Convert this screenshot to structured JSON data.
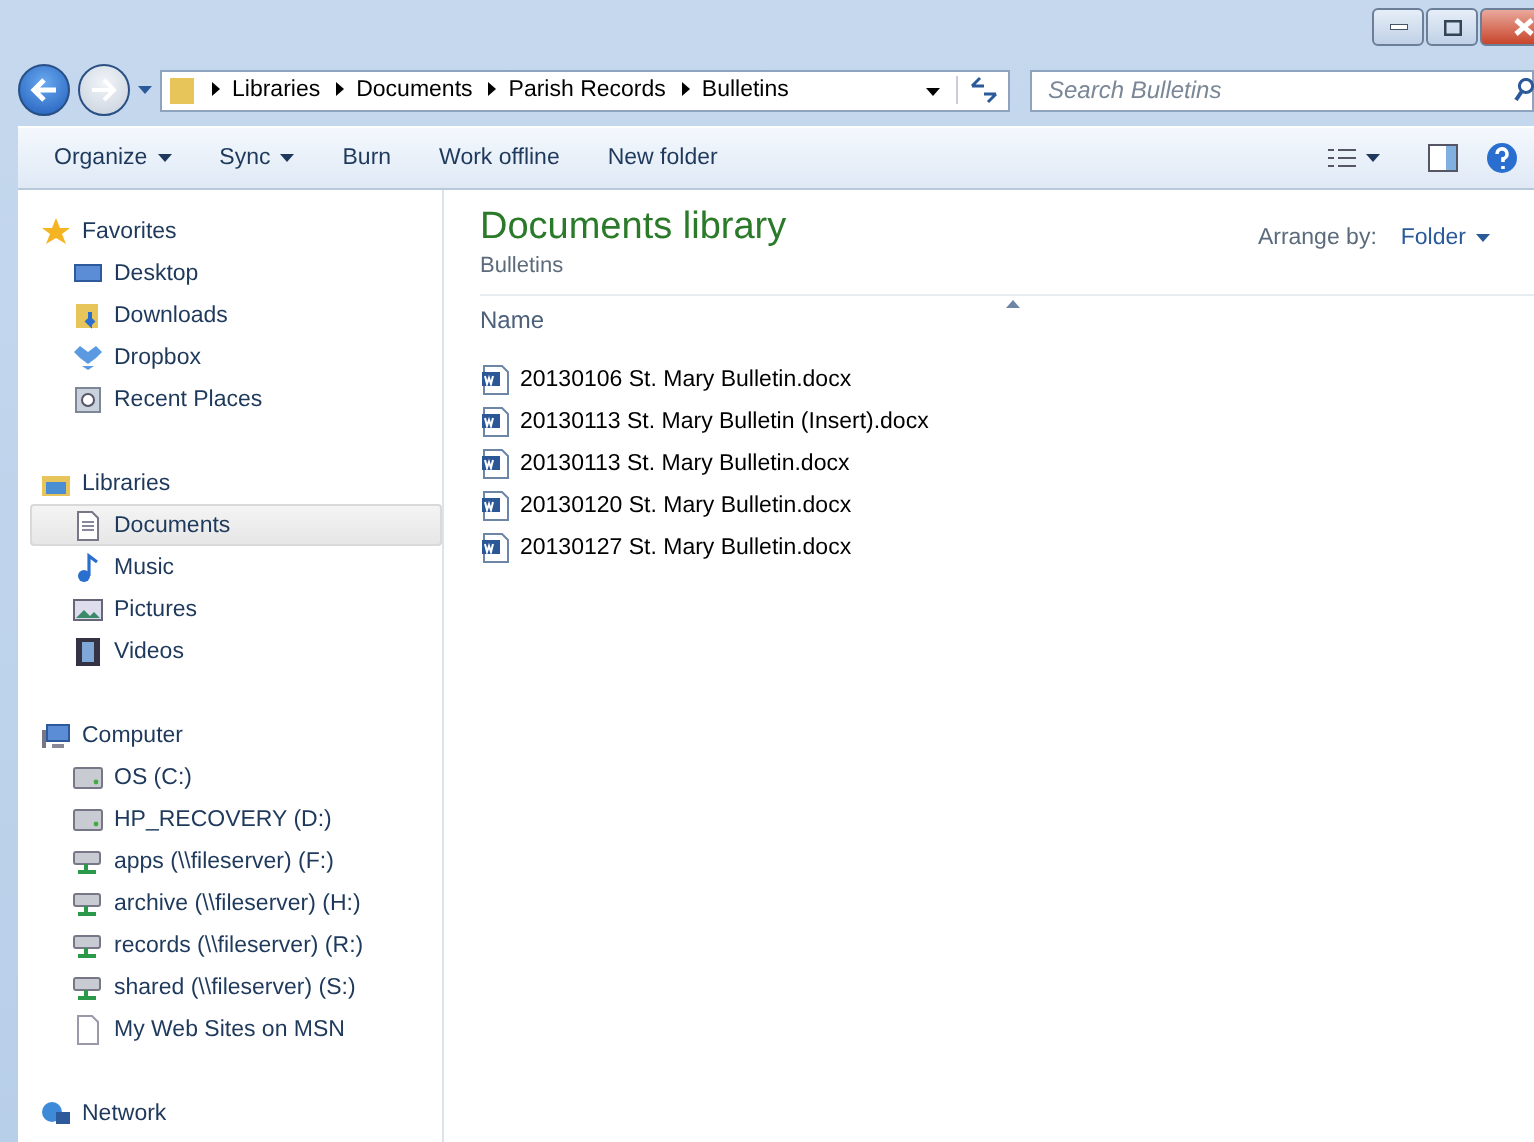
{
  "address_bar": {
    "breadcrumbs": [
      "Libraries",
      "Documents",
      "Parish Records",
      "Bulletins"
    ]
  },
  "search": {
    "placeholder": "Search Bulletins"
  },
  "toolbar": {
    "buttons": [
      {
        "label": "Organize",
        "dropdown": true
      },
      {
        "label": "Sync",
        "dropdown": true
      },
      {
        "label": "Burn",
        "dropdown": false
      },
      {
        "label": "Work offline",
        "dropdown": false
      },
      {
        "label": "New folder",
        "dropdown": false
      }
    ]
  },
  "sidebar": {
    "groups": [
      {
        "label": "Favorites",
        "items": [
          {
            "label": "Desktop",
            "selected": false
          },
          {
            "label": "Downloads",
            "selected": false
          },
          {
            "label": "Dropbox",
            "selected": false
          },
          {
            "label": "Recent Places",
            "selected": false
          }
        ]
      },
      {
        "label": "Libraries",
        "items": [
          {
            "label": "Documents",
            "selected": true
          },
          {
            "label": "Music",
            "selected": false
          },
          {
            "label": "Pictures",
            "selected": false
          },
          {
            "label": "Videos",
            "selected": false
          }
        ]
      },
      {
        "label": "Computer",
        "items": [
          {
            "label": "OS (C:)",
            "selected": false
          },
          {
            "label": "HP_RECOVERY (D:)",
            "selected": false
          },
          {
            "label": "apps (\\\\fileserver) (F:)",
            "selected": false
          },
          {
            "label": "archive (\\\\fileserver) (H:)",
            "selected": false
          },
          {
            "label": "records (\\\\fileserver) (R:)",
            "selected": false
          },
          {
            "label": "shared (\\\\fileserver) (S:)",
            "selected": false
          },
          {
            "label": "My Web Sites on MSN",
            "selected": false
          }
        ]
      },
      {
        "label": "Network"
      }
    ]
  },
  "content": {
    "title": "Documents library",
    "subtitle": "Bulletins",
    "arrange_label": "Arrange by:",
    "arrange_value": "Folder",
    "columns": [
      "Name"
    ],
    "files": [
      {
        "name": "20130106 St. Mary Bulletin.docx"
      },
      {
        "name": "20130113 St. Mary Bulletin (Insert).docx"
      },
      {
        "name": "20130113 St. Mary Bulletin.docx"
      },
      {
        "name": "20130120 St. Mary Bulletin.docx"
      },
      {
        "name": "20130127 St. Mary Bulletin.docx"
      }
    ]
  }
}
